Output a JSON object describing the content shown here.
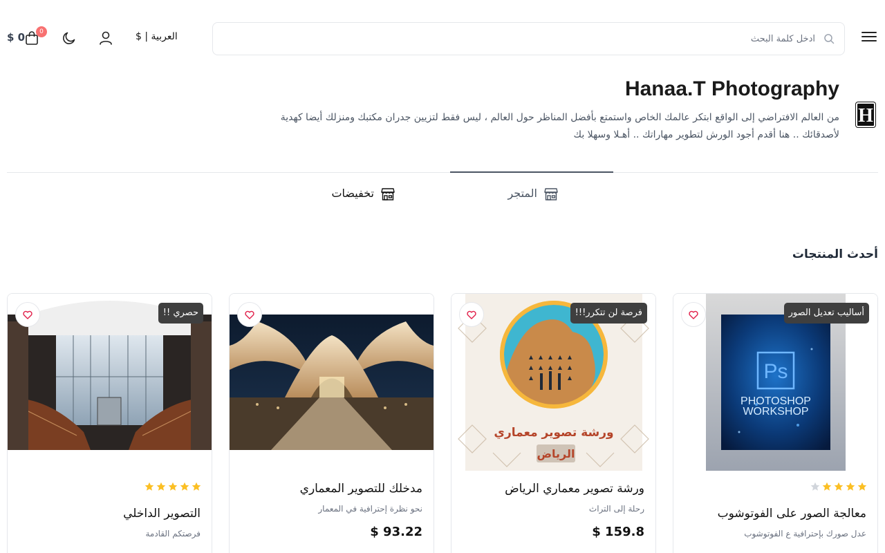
{
  "header": {
    "search_placeholder": "ادخل كلمة البحث",
    "language_label": "العربية | $",
    "cart_amount": "$ 0",
    "cart_count": "0"
  },
  "store": {
    "logo_letter": "H",
    "name": "Hanaa.T Photography",
    "description": "من العالم الافتراضي إلى الواقع ابتكر عالمك الخاص واستمتع بأفضل المناظر حول العالم ، ليس فقط لتزيين جدران مكتبك ومنزلك أيضا كهدية لأصدقائك .. هنا أقدم أجود الورش لتطوير مهاراتك .. أهـلا وسهلا بك"
  },
  "tabs": [
    {
      "label": "المتجر",
      "active": true
    },
    {
      "label": "تخفيضات",
      "active": false
    }
  ],
  "section_title": "أحدث المنتجات",
  "products": [
    {
      "badge": "أساليب تعديل الصور",
      "rating": 4,
      "title": "معالجة الصور على الفوتوشوب",
      "subtitle": "عدل صورك بإحترافية ع الفوتوشوب",
      "price": "",
      "image_text_1": "Ps",
      "image_text_2": "PHOTOSHOP",
      "image_text_3": "WORKSHOP"
    },
    {
      "badge": "فرصة لن تتكرر!!!",
      "rating": 0,
      "title": "ورشة تصوير معماري الرياض",
      "subtitle": "رحلة إلى التراث",
      "price": "$ 159.8",
      "image_text_1": "ورشة تصوير معماري",
      "image_text_2": "الرياض"
    },
    {
      "badge": "",
      "rating": 0,
      "title": "مدخلك للتصوير المعماري",
      "subtitle": "نحو نظرة إحترافية في المعمار",
      "price": "$ 93.22"
    },
    {
      "badge": "حصري !!",
      "rating": 5,
      "title": "التصوير الداخلي",
      "subtitle": "فرصتكم القادمة",
      "price": ""
    }
  ],
  "colors": {
    "badge_bg": "#3f3f3f",
    "star_filled": "#fbbf24",
    "star_empty": "#d1d5db",
    "cart_badge": "#f87171"
  }
}
